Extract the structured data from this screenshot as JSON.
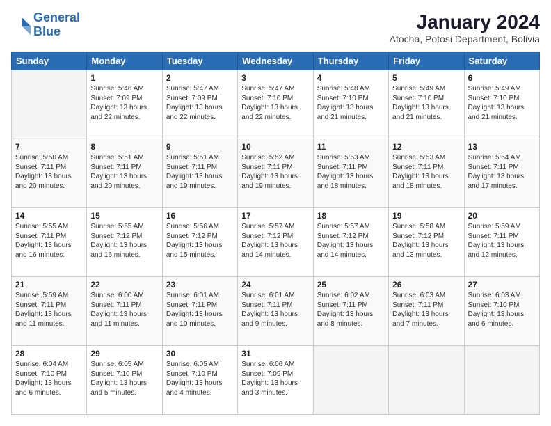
{
  "logo": {
    "line1": "General",
    "line2": "Blue"
  },
  "header": {
    "month": "January 2024",
    "location": "Atocha, Potosi Department, Bolivia"
  },
  "weekdays": [
    "Sunday",
    "Monday",
    "Tuesday",
    "Wednesday",
    "Thursday",
    "Friday",
    "Saturday"
  ],
  "weeks": [
    [
      {
        "day": "",
        "sunrise": "",
        "sunset": "",
        "daylight": ""
      },
      {
        "day": "1",
        "sunrise": "Sunrise: 5:46 AM",
        "sunset": "Sunset: 7:09 PM",
        "daylight": "Daylight: 13 hours and 22 minutes."
      },
      {
        "day": "2",
        "sunrise": "Sunrise: 5:47 AM",
        "sunset": "Sunset: 7:09 PM",
        "daylight": "Daylight: 13 hours and 22 minutes."
      },
      {
        "day": "3",
        "sunrise": "Sunrise: 5:47 AM",
        "sunset": "Sunset: 7:10 PM",
        "daylight": "Daylight: 13 hours and 22 minutes."
      },
      {
        "day": "4",
        "sunrise": "Sunrise: 5:48 AM",
        "sunset": "Sunset: 7:10 PM",
        "daylight": "Daylight: 13 hours and 21 minutes."
      },
      {
        "day": "5",
        "sunrise": "Sunrise: 5:49 AM",
        "sunset": "Sunset: 7:10 PM",
        "daylight": "Daylight: 13 hours and 21 minutes."
      },
      {
        "day": "6",
        "sunrise": "Sunrise: 5:49 AM",
        "sunset": "Sunset: 7:10 PM",
        "daylight": "Daylight: 13 hours and 21 minutes."
      }
    ],
    [
      {
        "day": "7",
        "sunrise": "Sunrise: 5:50 AM",
        "sunset": "Sunset: 7:11 PM",
        "daylight": "Daylight: 13 hours and 20 minutes."
      },
      {
        "day": "8",
        "sunrise": "Sunrise: 5:51 AM",
        "sunset": "Sunset: 7:11 PM",
        "daylight": "Daylight: 13 hours and 20 minutes."
      },
      {
        "day": "9",
        "sunrise": "Sunrise: 5:51 AM",
        "sunset": "Sunset: 7:11 PM",
        "daylight": "Daylight: 13 hours and 19 minutes."
      },
      {
        "day": "10",
        "sunrise": "Sunrise: 5:52 AM",
        "sunset": "Sunset: 7:11 PM",
        "daylight": "Daylight: 13 hours and 19 minutes."
      },
      {
        "day": "11",
        "sunrise": "Sunrise: 5:53 AM",
        "sunset": "Sunset: 7:11 PM",
        "daylight": "Daylight: 13 hours and 18 minutes."
      },
      {
        "day": "12",
        "sunrise": "Sunrise: 5:53 AM",
        "sunset": "Sunset: 7:11 PM",
        "daylight": "Daylight: 13 hours and 18 minutes."
      },
      {
        "day": "13",
        "sunrise": "Sunrise: 5:54 AM",
        "sunset": "Sunset: 7:11 PM",
        "daylight": "Daylight: 13 hours and 17 minutes."
      }
    ],
    [
      {
        "day": "14",
        "sunrise": "Sunrise: 5:55 AM",
        "sunset": "Sunset: 7:11 PM",
        "daylight": "Daylight: 13 hours and 16 minutes."
      },
      {
        "day": "15",
        "sunrise": "Sunrise: 5:55 AM",
        "sunset": "Sunset: 7:12 PM",
        "daylight": "Daylight: 13 hours and 16 minutes."
      },
      {
        "day": "16",
        "sunrise": "Sunrise: 5:56 AM",
        "sunset": "Sunset: 7:12 PM",
        "daylight": "Daylight: 13 hours and 15 minutes."
      },
      {
        "day": "17",
        "sunrise": "Sunrise: 5:57 AM",
        "sunset": "Sunset: 7:12 PM",
        "daylight": "Daylight: 13 hours and 14 minutes."
      },
      {
        "day": "18",
        "sunrise": "Sunrise: 5:57 AM",
        "sunset": "Sunset: 7:12 PM",
        "daylight": "Daylight: 13 hours and 14 minutes."
      },
      {
        "day": "19",
        "sunrise": "Sunrise: 5:58 AM",
        "sunset": "Sunset: 7:12 PM",
        "daylight": "Daylight: 13 hours and 13 minutes."
      },
      {
        "day": "20",
        "sunrise": "Sunrise: 5:59 AM",
        "sunset": "Sunset: 7:11 PM",
        "daylight": "Daylight: 13 hours and 12 minutes."
      }
    ],
    [
      {
        "day": "21",
        "sunrise": "Sunrise: 5:59 AM",
        "sunset": "Sunset: 7:11 PM",
        "daylight": "Daylight: 13 hours and 11 minutes."
      },
      {
        "day": "22",
        "sunrise": "Sunrise: 6:00 AM",
        "sunset": "Sunset: 7:11 PM",
        "daylight": "Daylight: 13 hours and 11 minutes."
      },
      {
        "day": "23",
        "sunrise": "Sunrise: 6:01 AM",
        "sunset": "Sunset: 7:11 PM",
        "daylight": "Daylight: 13 hours and 10 minutes."
      },
      {
        "day": "24",
        "sunrise": "Sunrise: 6:01 AM",
        "sunset": "Sunset: 7:11 PM",
        "daylight": "Daylight: 13 hours and 9 minutes."
      },
      {
        "day": "25",
        "sunrise": "Sunrise: 6:02 AM",
        "sunset": "Sunset: 7:11 PM",
        "daylight": "Daylight: 13 hours and 8 minutes."
      },
      {
        "day": "26",
        "sunrise": "Sunrise: 6:03 AM",
        "sunset": "Sunset: 7:11 PM",
        "daylight": "Daylight: 13 hours and 7 minutes."
      },
      {
        "day": "27",
        "sunrise": "Sunrise: 6:03 AM",
        "sunset": "Sunset: 7:10 PM",
        "daylight": "Daylight: 13 hours and 6 minutes."
      }
    ],
    [
      {
        "day": "28",
        "sunrise": "Sunrise: 6:04 AM",
        "sunset": "Sunset: 7:10 PM",
        "daylight": "Daylight: 13 hours and 6 minutes."
      },
      {
        "day": "29",
        "sunrise": "Sunrise: 6:05 AM",
        "sunset": "Sunset: 7:10 PM",
        "daylight": "Daylight: 13 hours and 5 minutes."
      },
      {
        "day": "30",
        "sunrise": "Sunrise: 6:05 AM",
        "sunset": "Sunset: 7:10 PM",
        "daylight": "Daylight: 13 hours and 4 minutes."
      },
      {
        "day": "31",
        "sunrise": "Sunrise: 6:06 AM",
        "sunset": "Sunset: 7:09 PM",
        "daylight": "Daylight: 13 hours and 3 minutes."
      },
      {
        "day": "",
        "sunrise": "",
        "sunset": "",
        "daylight": ""
      },
      {
        "day": "",
        "sunrise": "",
        "sunset": "",
        "daylight": ""
      },
      {
        "day": "",
        "sunrise": "",
        "sunset": "",
        "daylight": ""
      }
    ]
  ]
}
